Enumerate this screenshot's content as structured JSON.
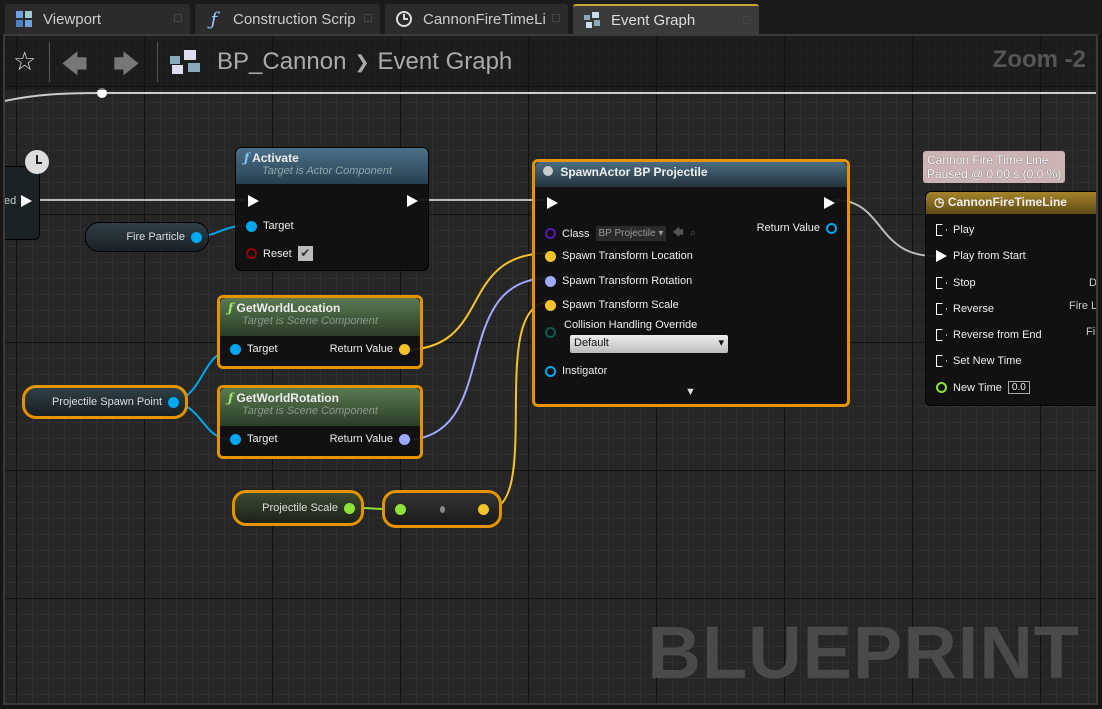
{
  "tabs": [
    {
      "label": "Viewport",
      "icon": "viewport-icon"
    },
    {
      "label": "Construction Scrip",
      "icon": "function-icon"
    },
    {
      "label": "CannonFireTimeLi",
      "icon": "clock-icon"
    },
    {
      "label": "Event Graph",
      "icon": "graph-icon",
      "active": true
    }
  ],
  "breadcrumb": {
    "blueprint": "BP_Cannon",
    "separator": "❯",
    "graph": "Event Graph"
  },
  "zoom": "Zoom -2",
  "watermark": "BLUEPRINT",
  "nodes": {
    "partial": {
      "pin": "ed"
    },
    "activate": {
      "title": "Activate",
      "subtitle": "Target is Actor Component",
      "pins": {
        "target": "Target",
        "reset": "Reset"
      },
      "reset_checked": true
    },
    "fire_particle": {
      "label": "Fire Particle"
    },
    "get_world_location": {
      "title": "GetWorldLocation",
      "subtitle": "Target is Scene Component",
      "target": "Target",
      "return": "Return Value"
    },
    "get_world_rotation": {
      "title": "GetWorldRotation",
      "subtitle": "Target is Scene Component",
      "target": "Target",
      "return": "Return Value"
    },
    "projectile_spawn_point": {
      "label": "Projectile Spawn Point"
    },
    "projectile_scale": {
      "label": "Projectile Scale"
    },
    "spawn_actor": {
      "title": "SpawnActor BP Projectile",
      "class_label": "Class",
      "class_value": "BP Projectile",
      "return": "Return Value",
      "location": "Spawn Transform Location",
      "rotation": "Spawn Transform Rotation",
      "scale": "Spawn Transform Scale",
      "collision": "Collision Handling Override",
      "collision_value": "Default",
      "instigator": "Instigator"
    },
    "timeline": {
      "tooltip_title": "Cannon Fire Time Line",
      "tooltip_status": "Paused @ 0.00 s (0.0 %)",
      "title": "CannonFireTimeLine",
      "pins": [
        "Play",
        "Play from Start",
        "Stop",
        "Reverse",
        "Reverse from End",
        "Set New Time"
      ],
      "new_time_label": "New Time",
      "new_time_value": "0.0",
      "outputs": [
        "D",
        "Fire L",
        "Fi"
      ]
    }
  },
  "colors": {
    "exec": "#ffffff",
    "object": "#00a8f0",
    "vector": "#f5c32a",
    "rotator": "#a0a8ff",
    "float": "#8fe23a",
    "selection": "#e59400",
    "timeline_header": "#8a6d1e"
  }
}
